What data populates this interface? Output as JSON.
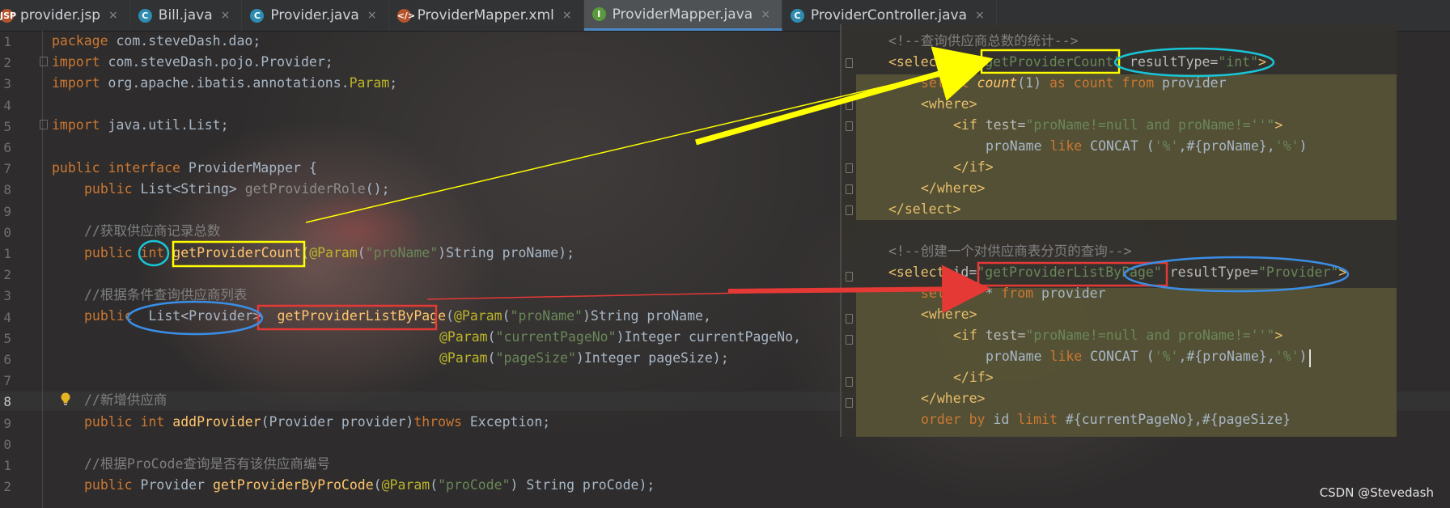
{
  "tabs": [
    {
      "label": "provider.jsp",
      "icon": "jsp-file-icon"
    },
    {
      "label": "Bill.java",
      "icon": "class-icon"
    },
    {
      "label": "Provider.java",
      "icon": "class-icon"
    },
    {
      "label": "ProviderMapper.xml",
      "icon": "xml-file-icon"
    },
    {
      "label": "ProviderMapper.java",
      "icon": "interface-icon"
    },
    {
      "label": "ProviderController.java",
      "icon": "class-icon"
    }
  ],
  "active_tab": 4,
  "line_numbers": [
    "1",
    "2",
    "3",
    "4",
    "5",
    "6",
    "7",
    "8",
    "9",
    "0",
    "1",
    "2",
    "3",
    "4",
    "5",
    "6",
    "7",
    "8",
    "9",
    "0",
    "1",
    "2"
  ],
  "current_line_index": 17,
  "java": {
    "l1_kw": "package",
    "l1_rest": " com.steveDash.dao;",
    "l2_kw": "import",
    "l2_rest": " com.steveDash.pojo.Provider;",
    "l3_kw": "import",
    "l3_a": " org.apache.ibatis.annotations.",
    "l3_b": "Param",
    "l3_c": ";",
    "l5_kw": "import",
    "l5_rest": " java.util.List;",
    "l7_kw1": "public",
    "l7_kw2": " interface",
    "l7_rest": " ProviderMapper {",
    "l8_kw": "public",
    "l8_a": " List<String> ",
    "l8_fn": "getProviderRole",
    "l8_b": "();",
    "l10_cm": "//获取供应商记录总数",
    "l11_kw1": "public",
    "l11_kw2": "int",
    "l11_fn": "getProviderCount",
    "l11_a": "(",
    "l11_an": "@Param",
    "l11_b": "(",
    "l11_st": "\"proName\"",
    "l11_c": ")String proName);",
    "l13_cm": "//根据条件查询供应商列表",
    "l14_kw": "public",
    "l14_a": "List<Provider>",
    "l14_fn": "getProviderListByPage",
    "l14_b": "(",
    "l14_an": "@Param",
    "l14_c": "(",
    "l14_st": "\"proName\"",
    "l14_d": ")String proName,",
    "l15_an": "@Param",
    "l15_a": "(",
    "l15_st": "\"currentPageNo\"",
    "l15_b": ")Integer currentPageNo,",
    "l16_an": "@Param",
    "l16_a": "(",
    "l16_st": "\"pageSize\"",
    "l16_b": ")Integer pageSize);",
    "l18_cm": "//新增供应商",
    "l19_kw1": "public",
    "l19_kw2": " int",
    "l19_fn": " addProvider",
    "l19_a": "(Provider provider)",
    "l19_kw3": "throws",
    "l19_b": " Exception;",
    "l21_cm": "//根据ProCode查询是否有该供应商编号",
    "l22_kw": "public",
    "l22_a": " Provider ",
    "l22_fn": "getProviderByProCode",
    "l22_b": "(",
    "l22_an": "@Param",
    "l22_c": "(",
    "l22_st": "\"proCode\"",
    "l22_d": ") String proCode);"
  },
  "xml": {
    "x1": "<!--查询供应商总数的统计-->",
    "x2_t": "<select",
    "x2_a": " id=",
    "x2_v": "\"getProviderCount\"",
    "x2_a2": " resultType=",
    "x2_v2": "\"int\"",
    "x2_t2": ">",
    "x3_a": "select ",
    "x3_b": "count",
    "x3_c": "(1)",
    "x3_d": " as",
    "x3_e": " count",
    "x3_f": " from",
    "x3_g": " provider",
    "x4": "<where>",
    "x5_t": "<if",
    "x5_a": " test=",
    "x5_v": "\"proName!=null and proName!=''\"",
    "x5_t2": ">",
    "x6_a": "proName",
    "x6_b": " like",
    "x6_c": " CONCAT (",
    "x6_d": "'%'",
    "x6_e": ",#{proName},",
    "x6_f": "'%'",
    "x6_g": ")",
    "x7": "</if>",
    "x8": "</where>",
    "x9": "</select>",
    "x11": "<!--创建一个对供应商表分页的查询-->",
    "x12_t": "<select",
    "x12_a": " id=",
    "x12_v": "\"getProviderListByPage\"",
    "x12_a2": " resultType=",
    "x12_v2": "\"Provider\"",
    "x12_t2": ">",
    "x13_a": "select",
    "x13_b": "  * ",
    "x13_c": "from",
    "x13_d": " provider",
    "x14": "<where>",
    "x15_t": "<if",
    "x15_a": " test=",
    "x15_v": "\"proName!=null and proName!=''\"",
    "x15_t2": ">",
    "x16_a": "proName",
    "x16_b": " like",
    "x16_c": " CONCAT (",
    "x16_d": "'%'",
    "x16_e": ",#{proName},",
    "x16_f": "'%'",
    "x16_g": ")",
    "x17": "</if>",
    "x18": "</where>",
    "x19_a": "order by",
    "x19_b": " id ",
    "x19_c": "limit",
    "x19_d": " #{currentPageNo},#{pageSize}"
  },
  "colors": {
    "yellow_annotation": "#ffff00",
    "red_annotation": "#e53935",
    "cyan_annotation": "#18c6d8",
    "blue_annotation": "#3a8ee6"
  },
  "watermark": "CSDN @Stevedash"
}
